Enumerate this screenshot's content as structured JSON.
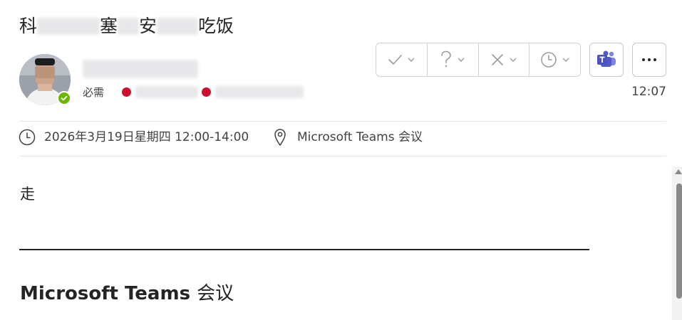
{
  "meeting": {
    "subject_parts": [
      "科",
      "塞",
      "安",
      "吃饭"
    ],
    "required_label": "必需",
    "received_time": "12:07",
    "datetime": "2026年3月19日星期四 12:00-14:00",
    "location": "Microsoft Teams 会议"
  },
  "body": {
    "text": "走",
    "teams_heading_en": "Microsoft Teams",
    "teams_heading_cn": "会议"
  },
  "colors": {
    "presence": "#6bb700",
    "declined": "#d10e2b",
    "teams": "#5059c9"
  },
  "icons": {
    "accept": "check-icon",
    "tentative": "question-icon",
    "decline": "x-icon",
    "propose": "clock-icon",
    "teams": "teams-icon",
    "more": "more-icon",
    "time": "clock-icon",
    "location": "map-pin-icon"
  }
}
